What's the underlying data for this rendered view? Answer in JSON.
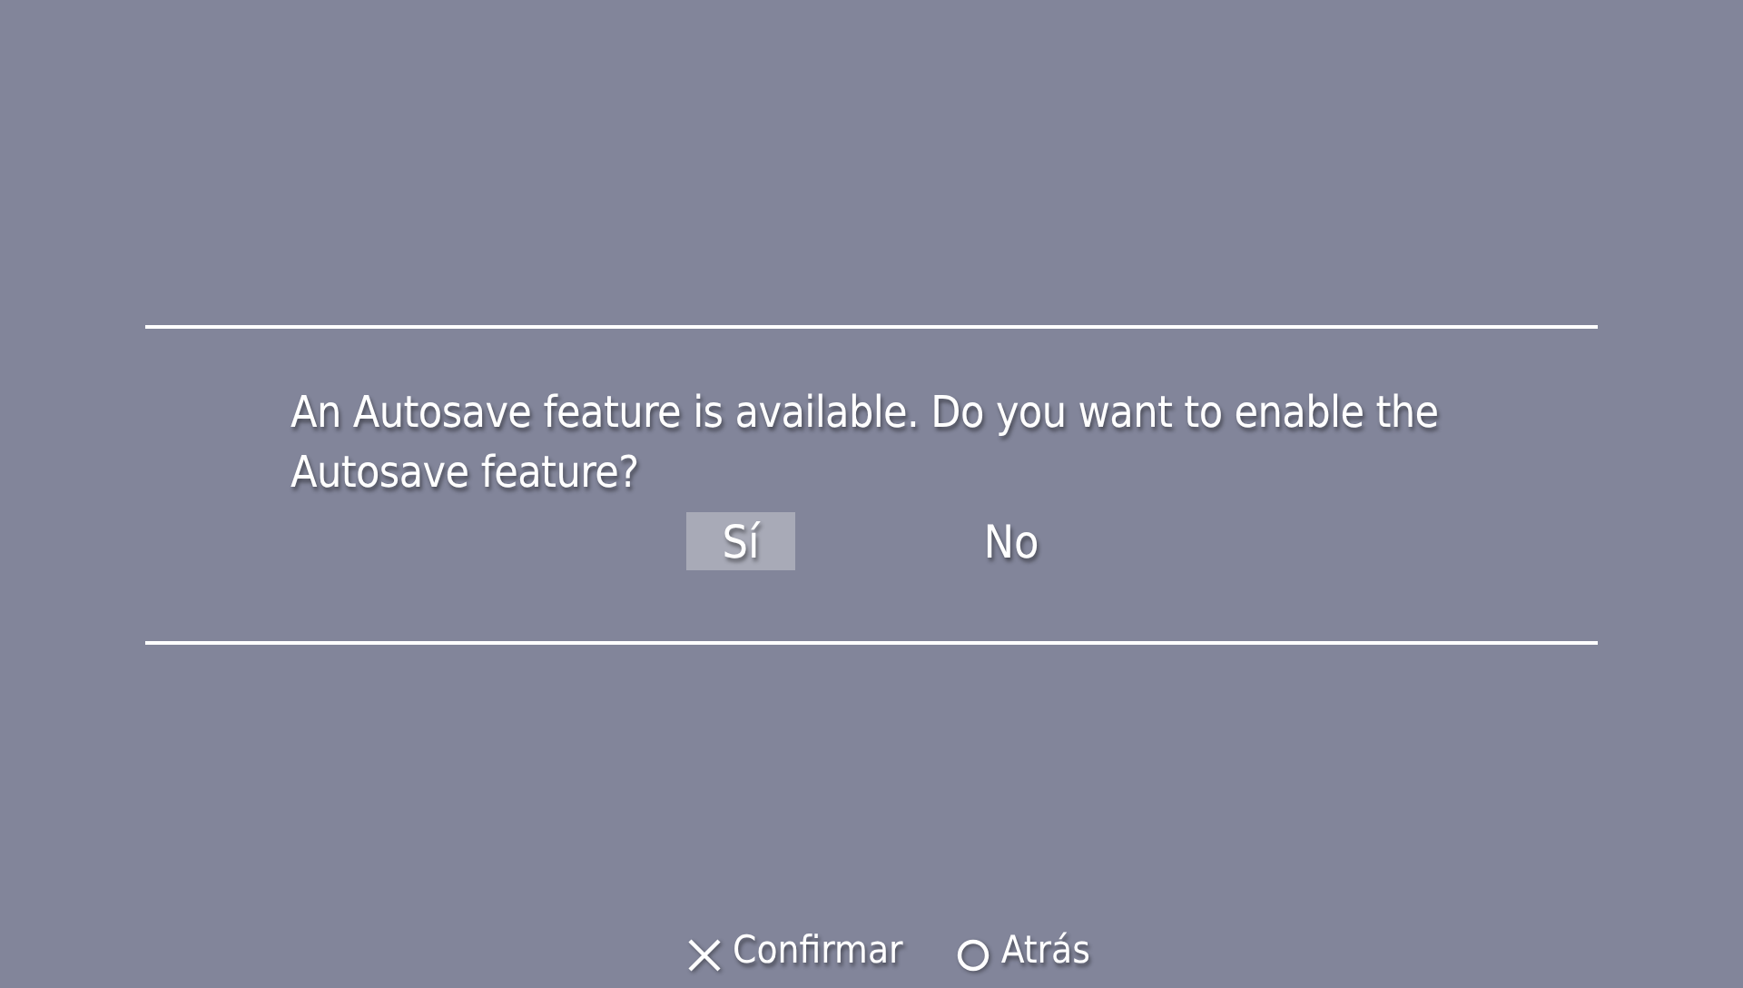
{
  "dialog": {
    "message": "An Autosave feature is available. Do you want to enable the Autosave feature?",
    "options": [
      {
        "label": "Sí",
        "selected": true
      },
      {
        "label": "No",
        "selected": false
      }
    ]
  },
  "footer": [
    {
      "kind": "cross",
      "label": "Confirmar"
    },
    {
      "kind": "circle",
      "label": "Atrás"
    }
  ]
}
